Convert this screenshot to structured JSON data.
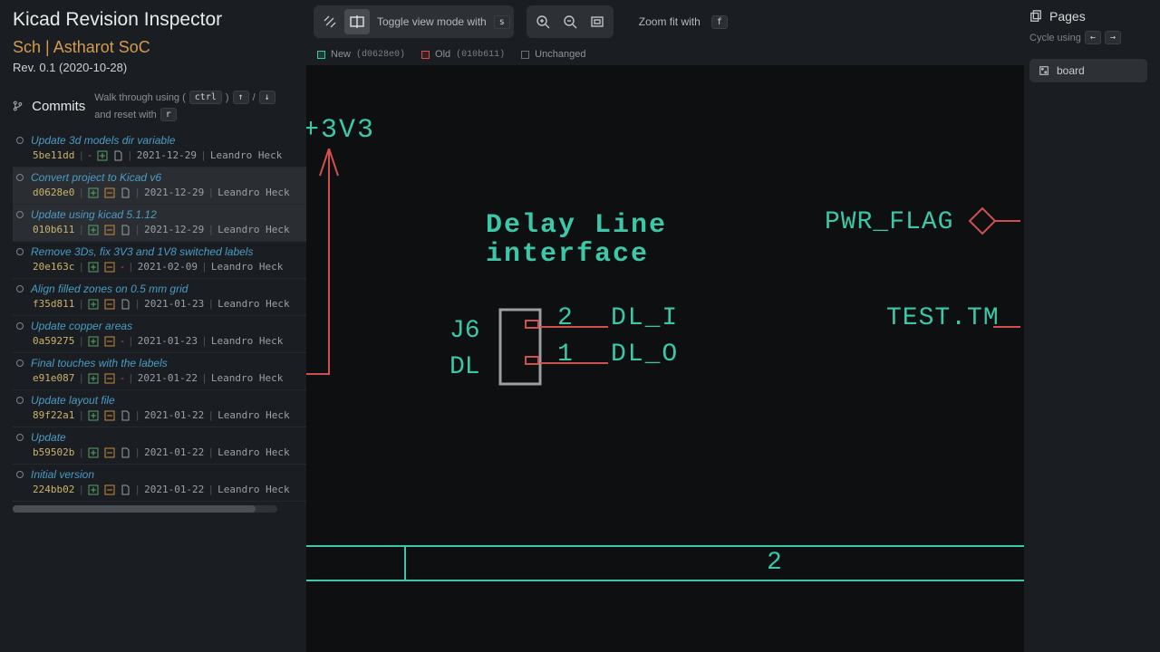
{
  "app": {
    "title": "Kicad Revision Inspector",
    "subtitle": "Sch | Astharot SoC",
    "revision": "Rev. 0.1 (2020-10-28)"
  },
  "commits": {
    "header": "Commits",
    "hint_prefix": "Walk through using (",
    "hint_key1": "ctrl",
    "hint_mid": ")",
    "hint_key2": "↑",
    "hint_sep": "/",
    "hint_key3": "↓",
    "hint_reset": "and reset with",
    "hint_reset_key": "r",
    "items": [
      {
        "msg": "Update 3d models dir variable",
        "hash": "5be11dd",
        "date": "2021-12-29",
        "author": "Leandro Heck",
        "style": "a"
      },
      {
        "msg": "Convert project to Kicad v6",
        "hash": "d0628e0",
        "date": "2021-12-29",
        "author": "Leandro Heck",
        "style": "b"
      },
      {
        "msg": "Update using kicad 5.1.12",
        "hash": "010b611",
        "date": "2021-12-29",
        "author": "Leandro Heck",
        "style": "b"
      },
      {
        "msg": "Remove 3Ds, fix 3V3 and 1V8 switched labels",
        "hash": "20e163c",
        "date": "2021-02-09",
        "author": "Leandro Heck",
        "style": "c"
      },
      {
        "msg": "Align filled zones on 0.5 mm grid",
        "hash": "f35d811",
        "date": "2021-01-23",
        "author": "Leandro Heck",
        "style": "b"
      },
      {
        "msg": "Update copper areas",
        "hash": "0a59275",
        "date": "2021-01-23",
        "author": "Leandro Heck",
        "style": "c"
      },
      {
        "msg": "Final touches with the labels",
        "hash": "e91e087",
        "date": "2021-01-22",
        "author": "Leandro Heck",
        "style": "c"
      },
      {
        "msg": "Update layout file",
        "hash": "89f22a1",
        "date": "2021-01-22",
        "author": "Leandro Heck",
        "style": "b"
      },
      {
        "msg": "Update",
        "hash": "b59502b",
        "date": "2021-01-22",
        "author": "Leandro Heck",
        "style": "b"
      },
      {
        "msg": "Initial version",
        "hash": "224bb02",
        "date": "2021-01-22",
        "author": "Leandro Heck",
        "style": "b"
      }
    ]
  },
  "toolbar": {
    "toggle_label": "Toggle view mode with",
    "toggle_key": "s",
    "zoom_label": "Zoom fit with",
    "zoom_key": "f"
  },
  "legend": {
    "new_label": "New",
    "new_hash": "(d0628e0)",
    "old_label": "Old",
    "old_hash": "(010b611)",
    "unchanged": "Unchanged"
  },
  "schematic": {
    "power": "+3V3",
    "title1": "Delay Line",
    "title2": "interface",
    "j6": "J6",
    "dl": "DL",
    "pin2": "2",
    "pin1": "1",
    "net_dli": "DL_I",
    "net_dlo": "DL_O",
    "pwrflag": "PWR_FLAG",
    "test": "TEST.TM",
    "col2": "2"
  },
  "pages": {
    "header": "Pages",
    "cycle_label": "Cycle using",
    "cycle_k1": "←",
    "cycle_k2": "→",
    "items": [
      {
        "label": "board"
      }
    ]
  }
}
